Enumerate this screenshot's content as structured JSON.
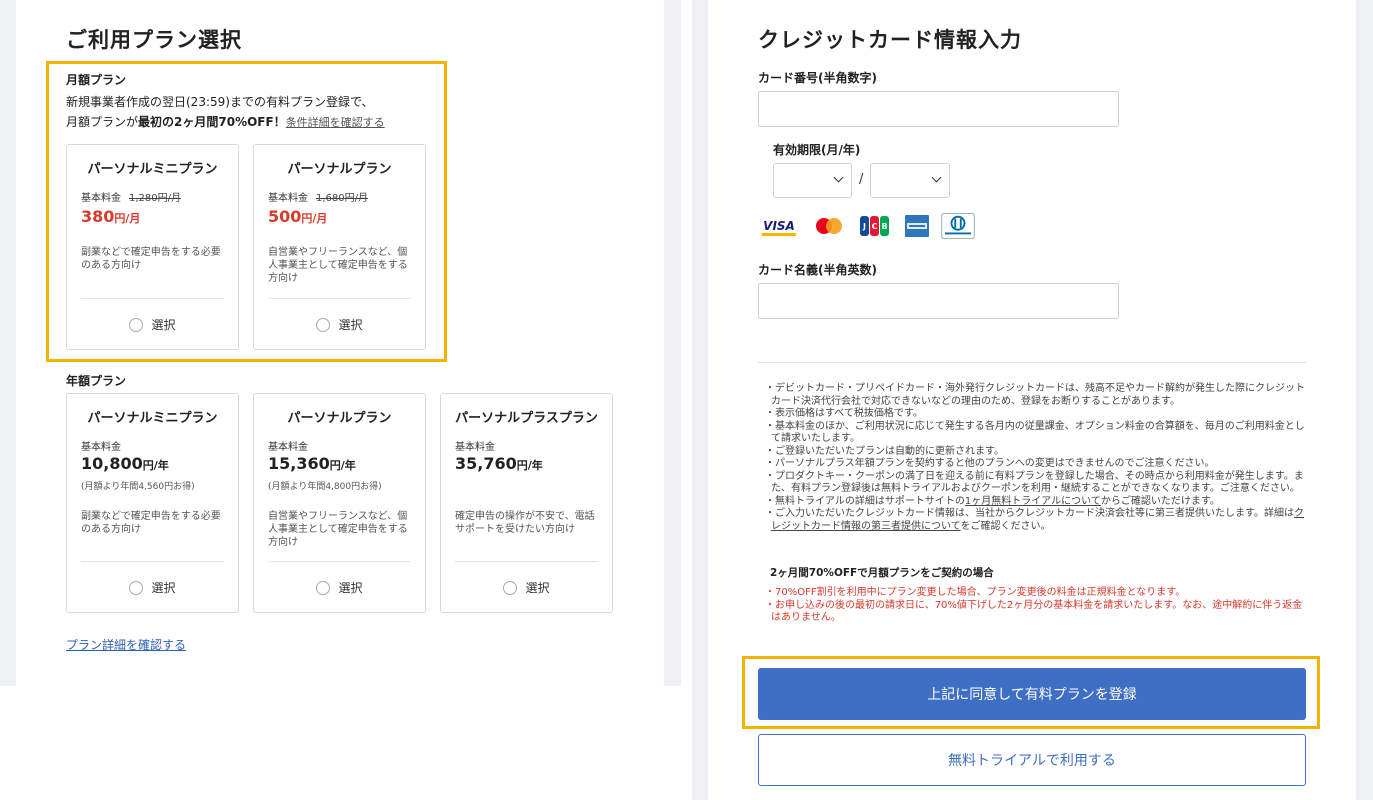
{
  "plan_select": {
    "title": "ご利用プラン選択",
    "monthly": {
      "label": "月額プラン",
      "promo_line1": "新規事業者作成の翌日(23:59)までの有料プラン登録で、",
      "promo_line2_prefix": "月額プランが",
      "promo_line2_bold": "最初の2ヶ月間70%OFF！",
      "promo_link": "条件詳細を確認する",
      "cards": [
        {
          "name": "パーソナルミニプラン",
          "base_label": "基本料金",
          "original_price": "1,280円/月",
          "price": "380",
          "price_unit": "円/月",
          "desc": "副業などで確定申告をする必要のある方向け",
          "select_label": "選択"
        },
        {
          "name": "パーソナルプラン",
          "base_label": "基本料金",
          "original_price": "1,680円/月",
          "price": "500",
          "price_unit": "円/月",
          "desc": "自営業やフリーランスなど、個人事業主として確定申告をする方向け",
          "select_label": "選択"
        }
      ]
    },
    "annual": {
      "label": "年額プラン",
      "cards": [
        {
          "name": "パーソナルミニプラン",
          "base_label": "基本料金",
          "price": "10,800",
          "price_unit": "円/年",
          "saving": "(月額より年間4,560円お得)",
          "desc": "副業などで確定申告をする必要のある方向け",
          "select_label": "選択"
        },
        {
          "name": "パーソナルプラン",
          "base_label": "基本料金",
          "price": "15,360",
          "price_unit": "円/年",
          "saving": "(月額より年間4,800円お得)",
          "desc": "自営業やフリーランスなど、個人事業主として確定申告をする方向け",
          "select_label": "選択"
        },
        {
          "name": "パーソナルプラスプラン",
          "base_label": "基本料金",
          "price": "35,760",
          "price_unit": "円/年",
          "desc": "確定申告の操作が不安で、電話サポートを受けたい方向け",
          "select_label": "選択"
        }
      ]
    },
    "details_link": "プラン詳細を確認する"
  },
  "card_form": {
    "title": "クレジットカード情報入力",
    "number_label": "カード番号(半角数字)",
    "number_value": "",
    "expiry_label": "有効期限(月/年)",
    "expiry_month": "",
    "expiry_year": "",
    "expiry_separator": "/",
    "brands": [
      "VISA",
      "mastercard",
      "JCB",
      "AMERICAN EXPRESS",
      "Diners Club INTERNATIONAL"
    ],
    "name_label": "カード名義(半角英数)",
    "name_value": ""
  },
  "notes": {
    "n1": "・デビットカード・プリペイドカード・海外発行クレジットカードは、残高不足やカード解約が発生した際にクレジットカード決済代行会社で対応できないなどの理由のため、登録をお断りすることがあります。",
    "n2": "・表示価格はすべて税抜価格です。",
    "n3": "・基本料金のほか、ご利用状況に応じて発生する各月内の従量課金、オプション料金の合算額を、毎月のご利用料金として請求いたします。",
    "n4": "・ご登録いただいたプランは自動的に更新されます。",
    "n5": "・パーソナルプラス年額プランを契約すると他のプランへの変更はできませんのでご注意ください。",
    "n6": "・プロダクトキー・クーポンの満了日を迎える前に有料プランを登録した場合、その時点から利用料金が発生します。また、有料プラン登録後は無料トライアルおよびクーポンを利用・継続することができなくなります。ご注意ください。",
    "n7_pre": "・無料トライアルの詳細はサポートサイトの",
    "n7_link": "1ヶ月無料トライアルについて",
    "n7_post": "からご確認いただけます。",
    "n8_pre": "・ご入力いただいたクレジットカード情報は、当社からクレジットカード決済会社等に第三者提供いたします。詳細は",
    "n8_link": "クレジットカード情報の第三者提供について",
    "n8_post": "をご確認ください。",
    "offer_heading": "2ヶ月間70%OFFで月額プランをご契約の場合",
    "r1": "・70%OFF割引を利用中にプラン変更した場合、プラン変更後の料金は正規料金となります。",
    "r2": "・お申し込みの後の最初の請求日に、70%値下げした2ヶ月分の基本料金を請求いたします。なお、途中解約に伴う返金はありません。"
  },
  "actions": {
    "primary": "上記に同意して有料プランを登録",
    "secondary": "無料トライアルで利用する"
  },
  "colors": {
    "highlight": "#f5b301",
    "primary_button": "#3f6fc4",
    "price_red": "#d93a2b",
    "link_blue": "#2f5fb3"
  }
}
